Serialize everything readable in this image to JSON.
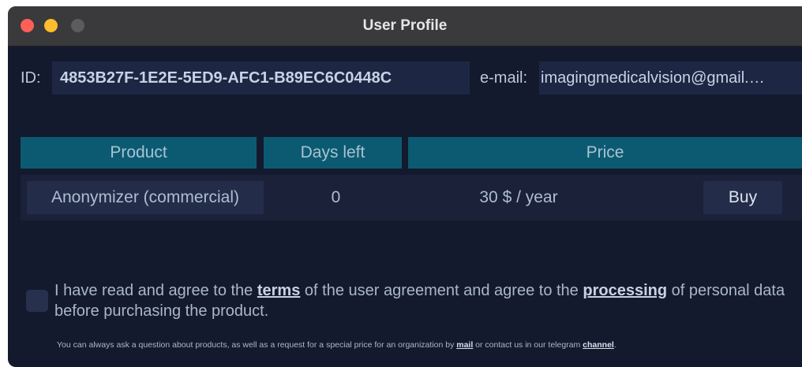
{
  "window": {
    "title": "User Profile"
  },
  "profile": {
    "id_label": "ID:",
    "id_value": "4853B27F-1E2E-5ED9-AFC1-B89EC6C0448C",
    "email_label": "e-mail:",
    "email_value": "imagingmedicalvision@gmail.…"
  },
  "table": {
    "headers": [
      "Product",
      "Days left",
      "Price"
    ],
    "rows": [
      {
        "product": "Anonymizer (commercial)",
        "days_left": "0",
        "price": "30 $ / year",
        "action": "Buy"
      }
    ]
  },
  "agreement": {
    "part1": "I have read and agree to the ",
    "terms_link": "terms",
    "part2": " of the user agreement and agree to the ",
    "processing_link": "processing",
    "part3": " of personal data before purchasing the product.",
    "checked": false
  },
  "footer": {
    "part1": "You can always ask a question about products, as well as a request for a special price for an organization by ",
    "mail_link": "mail",
    "part2": " or contact us in our telegram ",
    "channel_link": "channel",
    "part3": "."
  },
  "colors": {
    "background": "#131a2e",
    "header_accent": "#0c5a72",
    "close": "#fe5f57",
    "minimize": "#febc2e"
  }
}
